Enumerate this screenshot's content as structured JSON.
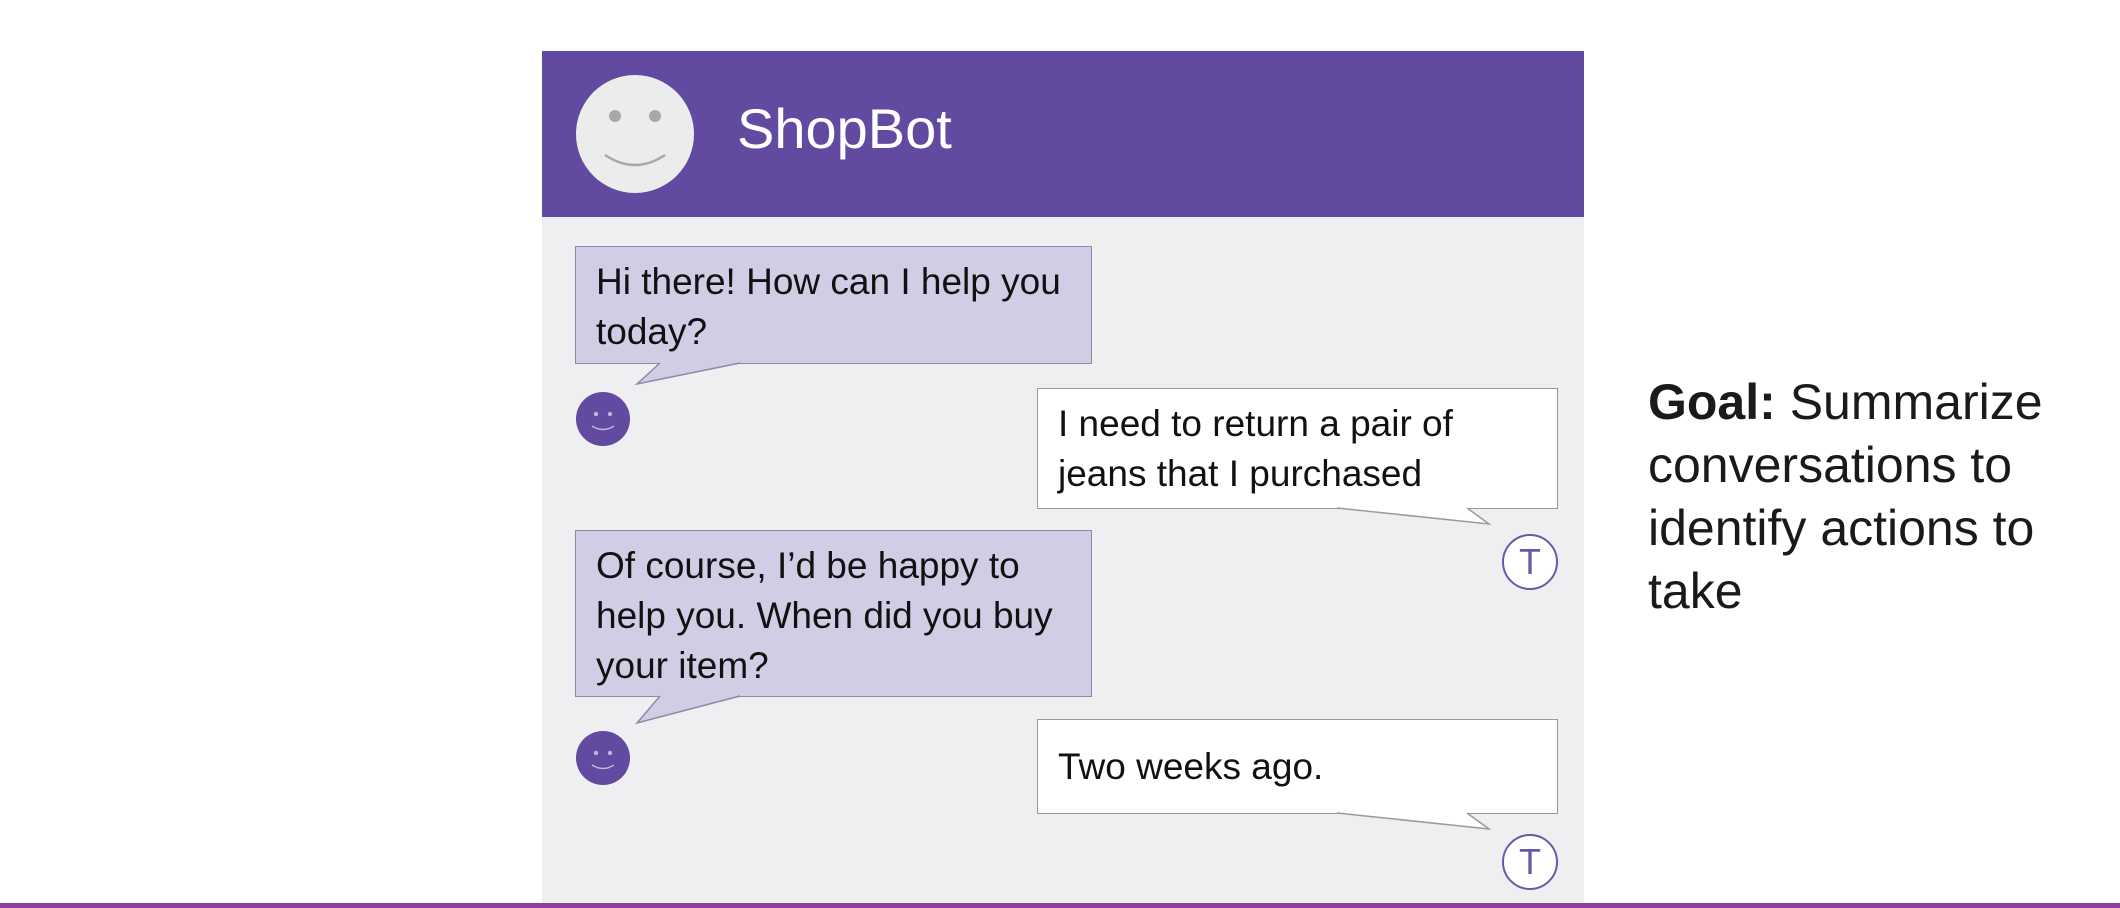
{
  "chat": {
    "bot_name": "ShopBot",
    "messages": [
      {
        "sender": "bot",
        "text": "Hi there! How can I help you today?"
      },
      {
        "sender": "user",
        "text": "I need to return a pair of jeans that I purchased"
      },
      {
        "sender": "bot",
        "text": "Of course, I’d be happy to help you. When did you buy your item?"
      },
      {
        "sender": "user",
        "text": "Two weeks ago."
      }
    ],
    "user_initial": "T",
    "icons": {
      "bot_header_avatar": "smiley-face-icon",
      "bot_message_avatar": "smiley-face-icon",
      "user_avatar": "user-initial-avatar"
    }
  },
  "goal": {
    "label": "Goal:",
    "text": "Summarize conversations to identify actions to take"
  },
  "colors": {
    "header": "#614a9f",
    "chat_background": "#efeff1",
    "bot_bubble": "#d2cce4",
    "user_bubble": "#ffffff",
    "accent": "#6a59a8",
    "bottom_bar": "#8f3fa0"
  }
}
